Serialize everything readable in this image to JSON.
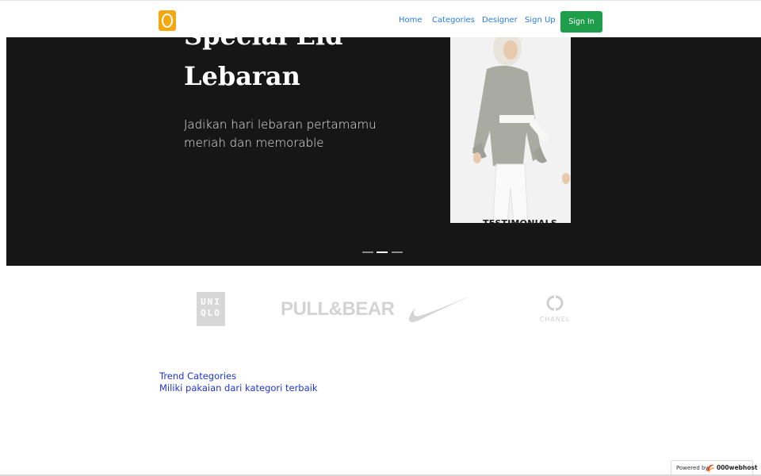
{
  "nav": {
    "links": [
      "Home",
      "Categories",
      "Designer",
      "Sign Up"
    ],
    "signin_label": "Sign In",
    "link_color": "#2a7be4",
    "signin_color": "#1e9e4a",
    "logo_color": "#f5a70f"
  },
  "hero": {
    "title_line1": "Special Eid",
    "title_line2": "Lebaran",
    "subtitle_line1": "Jadikan hari lebaran pertamamu",
    "subtitle_line2": "meriah dan memorable",
    "overlay_text": "TESTIMONIALS",
    "slide_count": 3,
    "active_slide": 2,
    "background": "#161616"
  },
  "brands": {
    "uniqlo_line1": "UNI",
    "uniqlo_line2": "QLO",
    "pullbear": "PULL&BEAR",
    "nike_icon": "nike-swoosh-icon",
    "chanel_icon": "chanel-cc-icon",
    "chanel_text": "CHANEL"
  },
  "trend": {
    "title": "Trend Categories",
    "subtitle": "Miliki pakaian dari kategori terbaik",
    "color": "#1f35d6"
  },
  "footer_badge": {
    "powered_label": "Powered by",
    "brand": "000webhost"
  }
}
